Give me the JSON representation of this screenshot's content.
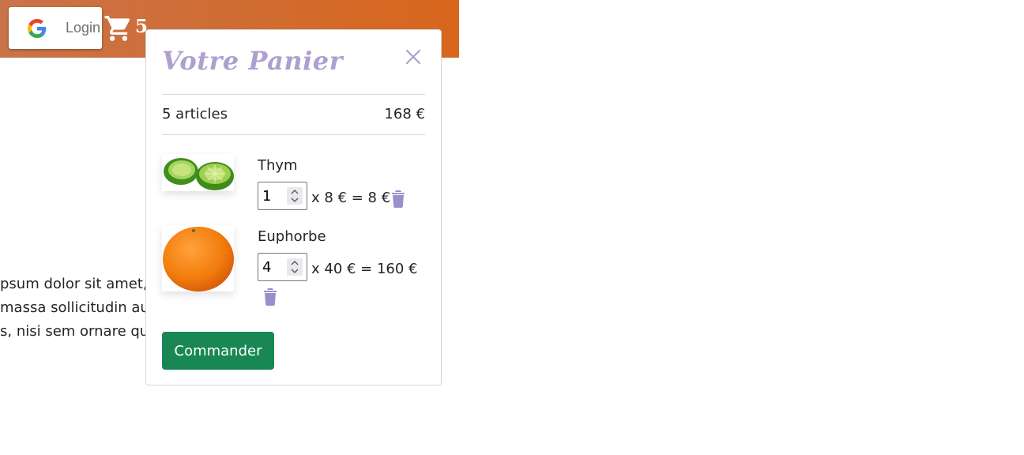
{
  "header": {
    "login_label": "Login",
    "google_icon": "google-g-icon",
    "cart_icon": "shopping-cart-icon",
    "cart_count": "5",
    "colors": {
      "gradient_start": "#c9734a",
      "gradient_end": "#d8661c"
    }
  },
  "background_text": {
    "lines": [
      "psum dolor sit amet,",
      "massa sollicitudin auc",
      "s, nisi sem ornare qua"
    ]
  },
  "cart": {
    "title": "Votre Panier",
    "close_icon": "close-icon",
    "summary": {
      "count_label": "5 articles",
      "total_label": "168 €"
    },
    "items": [
      {
        "name": "Thym",
        "quantity": "1",
        "calc": "x 8 € = 8 €",
        "image": "limes-image",
        "delete_icon": "trash-icon"
      },
      {
        "name": "Euphorbe",
        "quantity": "4",
        "calc": "x 40 € = 160 €",
        "image": "orange-image",
        "delete_icon": "trash-icon"
      }
    ],
    "order_button": "Commander",
    "colors": {
      "title": "#ad9fd0",
      "trash": "#9b8fcb",
      "order_button": "#198754"
    }
  }
}
